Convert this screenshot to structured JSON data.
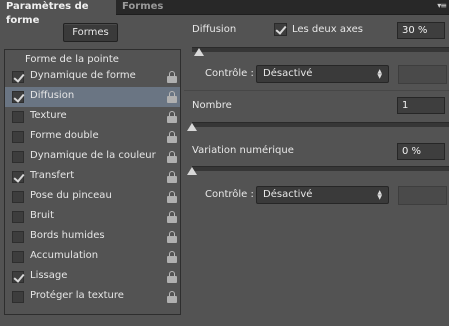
{
  "tabs": {
    "active": "Paramètres de forme",
    "inactive": "Formes"
  },
  "left": {
    "formes_button": "Formes",
    "header": "Forme de la pointe",
    "items": [
      {
        "label": "Dynamique de forme",
        "checked": true,
        "selected": false
      },
      {
        "label": "Diffusion",
        "checked": true,
        "selected": true
      },
      {
        "label": "Texture",
        "checked": false,
        "selected": false
      },
      {
        "label": "Forme double",
        "checked": false,
        "selected": false
      },
      {
        "label": "Dynamique de la couleur",
        "checked": false,
        "selected": false
      },
      {
        "label": "Transfert",
        "checked": true,
        "selected": false
      },
      {
        "label": "Pose du pinceau",
        "checked": false,
        "selected": false
      },
      {
        "label": "Bruit",
        "checked": false,
        "selected": false
      },
      {
        "label": "Bords humides",
        "checked": false,
        "selected": false
      },
      {
        "label": "Accumulation",
        "checked": false,
        "selected": false
      },
      {
        "label": "Lissage",
        "checked": true,
        "selected": false
      },
      {
        "label": "Protéger la texture",
        "checked": false,
        "selected": false
      }
    ]
  },
  "right": {
    "diffusion": {
      "label": "Diffusion",
      "both_axes_label": "Les deux axes",
      "both_axes_checked": true,
      "value": "30 %",
      "slider_fraction": 0.03
    },
    "control1": {
      "label": "Contrôle :",
      "value": "Désactivé"
    },
    "count": {
      "label": "Nombre",
      "value": "1",
      "slider_fraction": 0.0
    },
    "count_variation": {
      "label": "Variation numérique",
      "value": "0 %",
      "slider_fraction": 0.0
    },
    "control2": {
      "label": "Contrôle :",
      "value": "Désactivé"
    }
  },
  "colors": {
    "background": "#535353",
    "tabbar": "#282828",
    "selected_row": "#6a7583"
  }
}
